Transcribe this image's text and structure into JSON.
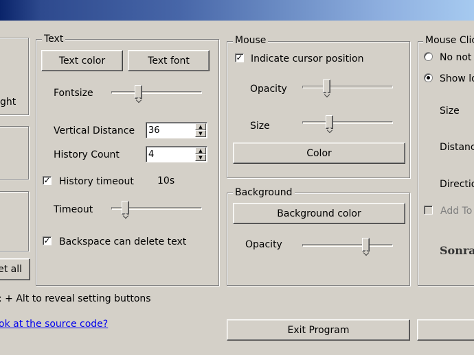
{
  "text_group": {
    "legend": "Text",
    "text_color_btn": "Text color",
    "text_font_btn": "Text font",
    "fontsize_label": "Fontsize",
    "fontsize_level": 0.28,
    "vertical_distance_label": "Vertical Distance",
    "vertical_distance_value": "36",
    "history_count_label": "History Count",
    "history_count_value": "4",
    "history_timeout_label": "History timeout",
    "history_timeout_checked": true,
    "history_timeout_value": "10s",
    "timeout_label": "Timeout",
    "timeout_level": 0.12,
    "backspace_label": "Backspace can delete text",
    "backspace_checked": true
  },
  "mouse_group": {
    "legend": "Mouse",
    "indicate_label": "Indicate cursor position",
    "indicate_checked": true,
    "opacity_label": "Opacity",
    "opacity_level": 0.25,
    "size_label": "Size",
    "size_level": 0.28,
    "color_btn": "Color"
  },
  "background_group": {
    "legend": "Background",
    "bg_color_btn": "Background color",
    "opacity_label": "Opacity",
    "opacity_level": 0.72
  },
  "mouse_click_group": {
    "legend": "Mouse Clic",
    "no_not_label": "No not",
    "show_label": "Show lo",
    "size_label": "Size",
    "distance_label": "Distanc",
    "direction_label": "Directio",
    "add_label": "Add To",
    "brand_text": "Sonra"
  },
  "left_partial": {
    "right_label": "ght",
    "reset_btn": "et all",
    "hint": ": + Alt to reveal setting buttons",
    "source_link": "ok at the source code?"
  },
  "bottom": {
    "exit_btn": "Exit Program"
  }
}
